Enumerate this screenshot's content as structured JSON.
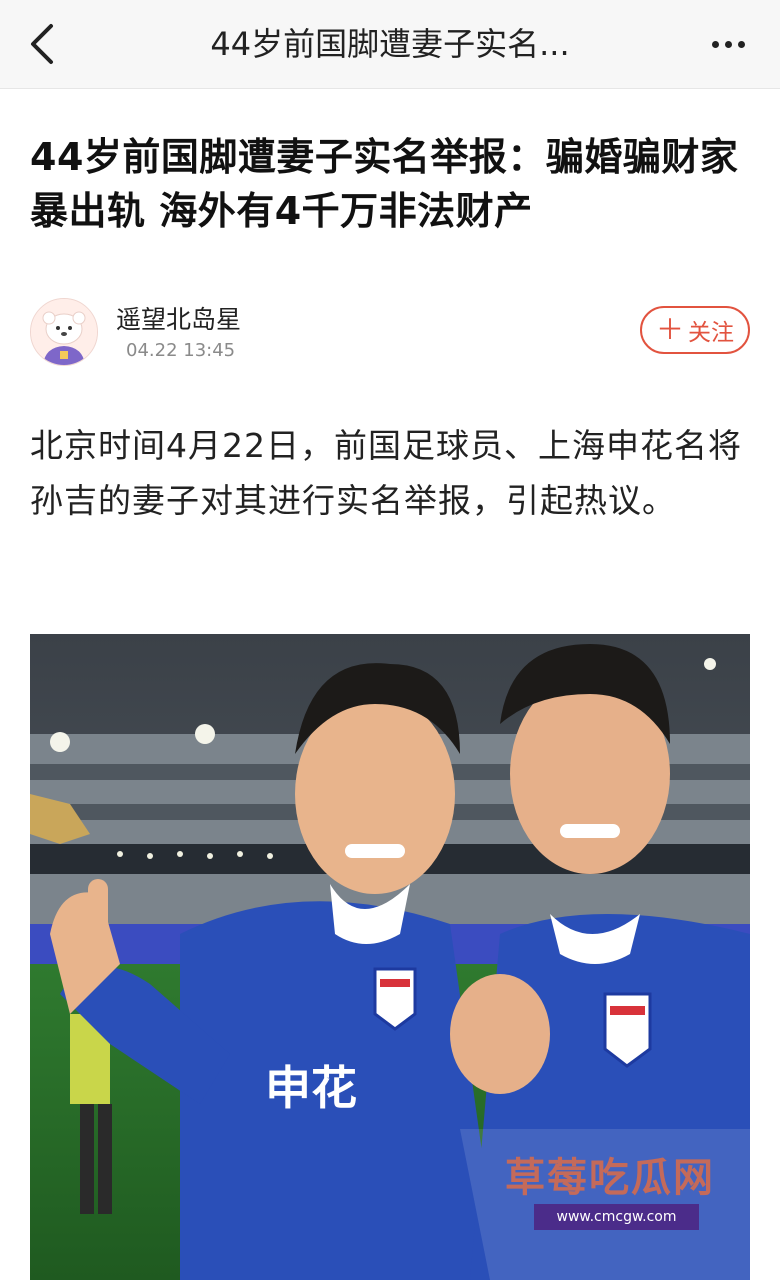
{
  "nav": {
    "title": "44岁前国脚遭妻子实名...",
    "back_icon": "chevron-left-icon",
    "more_icon": "more-dots-icon"
  },
  "article": {
    "headline": "44岁前国脚遭妻子实名举报：骗婚骗财家暴出轨 海外有4千万非法财产",
    "author": {
      "name": "遥望北岛星",
      "time": "04.22 13:45",
      "avatar_icon": "bear-avatar-icon"
    },
    "follow_plus": "＋",
    "follow_label": "关注",
    "paragraph": "北京时间4月22日，前国足球员、上海申花名将孙吉的妻子对其进行实名举报，引起热议。"
  },
  "photo": {
    "jersey_text": "申花",
    "watermark_text": "草莓吃瓜网",
    "watermark_url": "www.cmcgw.com"
  },
  "colors": {
    "accent": "#e2533f",
    "jersey_blue": "#2a4fb8",
    "nav_bg": "#f7f7f7"
  }
}
